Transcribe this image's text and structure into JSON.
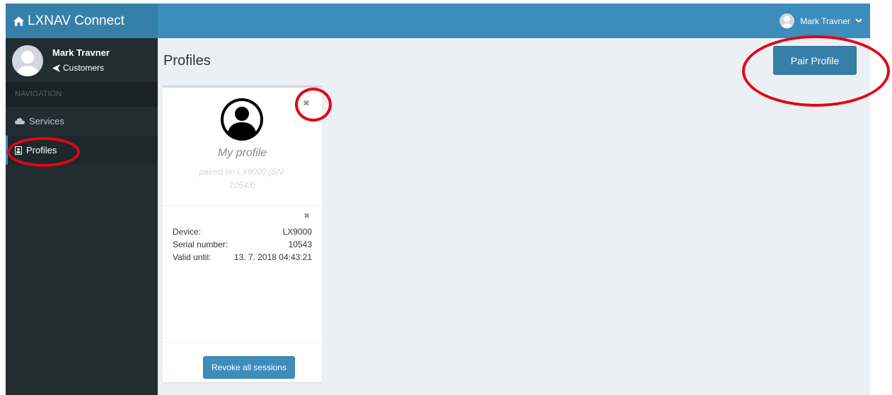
{
  "app": {
    "title": "LXNAV Connect"
  },
  "user": {
    "name": "Mark Travner",
    "role": "Customers"
  },
  "sidebar": {
    "header": "NAVIGATION",
    "items": [
      {
        "label": "Services",
        "icon": "cloud-icon",
        "active": false
      },
      {
        "label": "Profiles",
        "icon": "id-badge-icon",
        "active": true
      }
    ]
  },
  "main": {
    "title": "Profiles",
    "pair_button": "Pair Profile"
  },
  "profile_card": {
    "name": "My profile",
    "paired_line1": "paired on LX9000 (SN:",
    "paired_line2": "10543)",
    "device_label": "Device:",
    "device_value": "LX9000",
    "serial_label": "Serial number:",
    "serial_value": "10543",
    "valid_label": "Valid until:",
    "valid_value": "13. 7. 2018 04:43:21",
    "revoke_button": "Revoke all sessions",
    "close_glyph": "✖"
  },
  "colors": {
    "sidebar": "#222d32",
    "header": "#3c8dbc",
    "logo": "#367fa9",
    "annotation": "#e30613"
  }
}
